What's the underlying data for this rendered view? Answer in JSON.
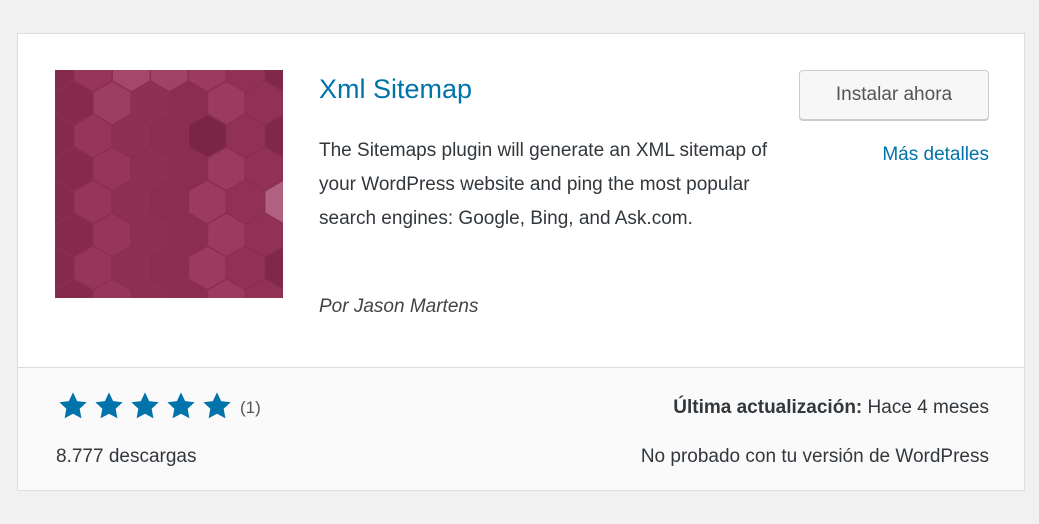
{
  "plugin": {
    "title": "Xml Sitemap",
    "description": "The Sitemaps plugin will generate an XML sitemap of your WordPress website and ping the most popular search engines: Google, Bing, and Ask.com.",
    "author": "Por Jason Martens",
    "icon": "hexagon-pattern-icon",
    "icon_color": "#8c2e52"
  },
  "actions": {
    "install_label": "Instalar ahora",
    "details_label": "Más detalles"
  },
  "stats": {
    "rating_stars": 5,
    "rating_max": 5,
    "rating_count": "(1)",
    "downloads": "8.777 descargas",
    "last_updated_label": "Última actualización:",
    "last_updated_value": "Hace 4 meses",
    "compatibility": "No probado con tu versión de WordPress",
    "star_color": "#0073aa"
  }
}
